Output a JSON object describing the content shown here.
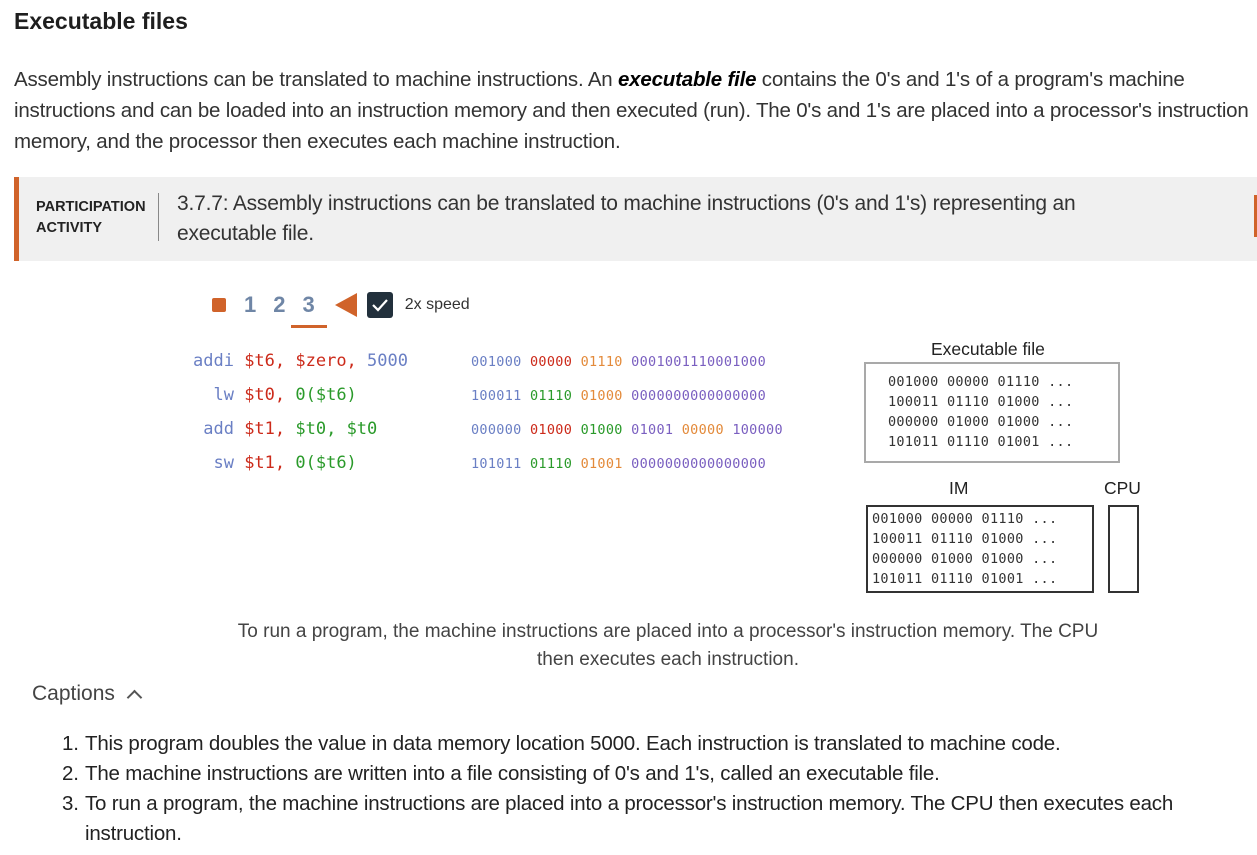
{
  "section_title": "Executable files",
  "intro": {
    "before": "Assembly instructions can be translated to machine instructions. An ",
    "bold": "executable file",
    "after": " contains the 0's and 1's of a program's machine instructions and can be loaded into an instruction memory and then executed (run). The 0's and 1's are placed into a processor's instruction memory, and the processor then executes each machine instruction."
  },
  "activity": {
    "label_line1": "PARTICIPATION",
    "label_line2": "ACTIVITY",
    "title": "3.7.7: Assembly instructions can be translated to machine instructions (0's and 1's) representing an executable file."
  },
  "controls": {
    "steps": [
      "1",
      "2",
      "3"
    ],
    "active_step": "3",
    "speed_label": "2x speed",
    "speed_checked": true
  },
  "assembly": [
    {
      "op": "addi",
      "args": [
        {
          "t": "$t6,",
          "c": "red"
        },
        {
          "t": "$zero,",
          "c": "red"
        },
        {
          "t": "5000",
          "c": "blue"
        }
      ]
    },
    {
      "op": "lw",
      "args": [
        {
          "t": "$t0,",
          "c": "red"
        },
        {
          "t": "0($t6)",
          "c": "green"
        }
      ]
    },
    {
      "op": "add",
      "args": [
        {
          "t": "$t1,",
          "c": "red"
        },
        {
          "t": "$t0,",
          "c": "green"
        },
        {
          "t": "$t0",
          "c": "green"
        }
      ]
    },
    {
      "op": "sw",
      "args": [
        {
          "t": "$t1,",
          "c": "red"
        },
        {
          "t": "0($t6)",
          "c": "green"
        }
      ]
    }
  ],
  "machine_code": [
    [
      {
        "t": "001000",
        "c": "blue"
      },
      {
        "t": "00000",
        "c": "red"
      },
      {
        "t": "01110",
        "c": "orange"
      },
      {
        "t": "0001001110001000",
        "c": "purple"
      }
    ],
    [
      {
        "t": "100011",
        "c": "blue"
      },
      {
        "t": "01110",
        "c": "green"
      },
      {
        "t": "01000",
        "c": "orange"
      },
      {
        "t": "0000000000000000",
        "c": "purple"
      }
    ],
    [
      {
        "t": "000000",
        "c": "blue"
      },
      {
        "t": "01000",
        "c": "red"
      },
      {
        "t": "01000",
        "c": "green"
      },
      {
        "t": "01001",
        "c": "purple"
      },
      {
        "t": "00000",
        "c": "orange"
      },
      {
        "t": "100000",
        "c": "purple"
      }
    ],
    [
      {
        "t": "101011",
        "c": "blue"
      },
      {
        "t": "01110",
        "c": "green"
      },
      {
        "t": "01001",
        "c": "orange"
      },
      {
        "t": "0000000000000000",
        "c": "purple"
      }
    ]
  ],
  "executable_file": {
    "label": "Executable file",
    "lines": [
      "001000 00000 01110 ...",
      "100011 01110 01000 ...",
      "000000 01000 01000 ...",
      "101011 01110 01001 ..."
    ]
  },
  "im": {
    "label": "IM",
    "lines": [
      "001000 00000 01110 ...",
      "100011 01110 01000 ...",
      "000000 01000 01000 ...",
      "101011 01110 01001 ..."
    ]
  },
  "cpu": {
    "label": "CPU"
  },
  "step_caption": "To run a program, the machine instructions are placed into a processor's instruction memory. The CPU then executes each instruction.",
  "captions": {
    "toggle_label": "Captions",
    "items": [
      "This program doubles the value in data memory location 5000. Each instruction is translated to machine code.",
      "The machine instructions are written into a file consisting of 0's and 1's, called an executable file.",
      "To run a program, the machine instructions are placed into a processor's instruction memory. The CPU then executes each instruction."
    ]
  },
  "colors": {
    "accent": "#d0632a",
    "step_blue": "#6f86a6",
    "header_bg": "#f0f0f0"
  }
}
